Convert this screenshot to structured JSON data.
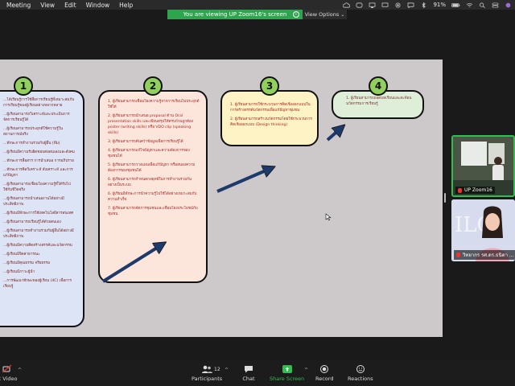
{
  "menubar": {
    "items": [
      "Meeting",
      "View",
      "Edit",
      "Window",
      "Help"
    ],
    "battery": "91%"
  },
  "share_banner": {
    "text": "You are viewing UP Zoom16's screen",
    "view_options": "View Options"
  },
  "slide": {
    "badges": [
      "1",
      "2",
      "3",
      "4"
    ],
    "card1": [
      "...ได้เรียนรู้การใช้สื่อการเรียนรู้ที่เหมาะสมกับการเรียนรู้ของผู้เรียนอย่างหลากหลาย",
      "...ผู้เรียนสามารถวิเคราะห์และประเมินการจัดการเรียนรู้ได้",
      "...ผู้เรียนสามารถประยุกต์ใช้ความรู้ในสถานการณ์จริง",
      "...ทักษะการทำงานร่วมกับผู้อื่น (ทีม)",
      "...ผู้เรียนมีความรับผิดชอบต่อตนเองและสังคม",
      "...ทักษะการสื่อสาร การนำเสนอ การอภิปราย",
      "...ทักษะการคิดวิเคราะห์ สังเคราะห์ และการแก้ปัญหา",
      "...ผู้เรียนสามารถเชื่อมโยงความรู้ที่ได้รับไปใช้กับชีวิตจริง",
      "...ผู้เรียนสามารถนำเสนองานได้อย่างมีประสิทธิภาพ",
      "...ผู้เรียนมีทักษะการใช้เทคโนโลยีสารสนเทศ",
      "...ผู้เรียนสามารถเรียนรู้ได้ด้วยตนเอง",
      "...ผู้เรียนสามารถทำงานร่วมกับผู้อื่นได้อย่างมีประสิทธิภาพ",
      "...ผู้เรียนมีความคิดสร้างสรรค์และนวัตกรรม",
      "...ผู้เรียนมีจิตสาธารณะ",
      "...ผู้เรียนมีคุณธรรม จริยธรรม",
      "...ผู้เรียนมีภาวะผู้นำ",
      "...การพัฒนาทักษะของผู้เรียน (4C) เพื่อการเรียนรู้"
    ],
    "card2": [
      "1. ผู้เรียนสามารถเชื่อมโยงความรู้จากการเรียนไปประยุกต์ใช้ได้",
      "2. ผู้เรียนสามารถนำเสนอ proposal ด้าน Oral presentation skills และเขียนสรุปให้ครบถ้วนถูกต้อง poster (writing skills) หรือ VDO clip (speaking skills)",
      "3. ผู้เรียนสามารถค้นคว้าข้อมูลเพื่อการเรียนรู้ได้",
      "4. ผู้เรียนสามารถแก้ไขปัญหาและความต้องการของชุมชนได้",
      "5. ผู้เรียนสามารถวางแผนเพื่อแก้ปัญหา หรือสนองความต้องการของชุมชนได้",
      "6. ผู้เรียนสามารถกำหนดกลยุทธ์ในการทำงานร่วมกันอย่างเป็นระบบ",
      "6. ผู้เรียนมีทักษะการนำความรู้ไปใช้ได้อย่างเหมาะสมกับความสำเร็จ",
      "7. ผู้เรียนสามารถจัดการชุมชนและเชื่อมโยงประโยชน์กับชุมชน"
    ],
    "card3": [
      "1. ผู้เรียนสามารถใช้กระบวนการคิดเชิงออกแบบในการสร้างสรรค์นวัตกรรมเพื่อแก้ปัญหาชุมชน",
      "2. ผู้เรียนสามารถสร้างนวัตกรรมโดยใช้กระบวนการคิดเชิงออกแบบ (Design thinking)"
    ],
    "card4": [
      "1. ผู้เรียนสามารถถอดบทเรียนและสะท้อนนวัตกรรมการเรียนรู้"
    ]
  },
  "participants": [
    {
      "name": "UP Zoom16"
    },
    {
      "name": "วิทยากร รศ.ดร.ธนิดา ..."
    }
  ],
  "controls": {
    "video_label": "rt Video",
    "participants_label": "Participants",
    "participants_count": "12",
    "chat_label": "Chat",
    "share_label": "Share Screen",
    "record_label": "Record",
    "reactions_label": "Reactions"
  },
  "colors": {
    "share_green": "#2ea44f",
    "badge_green": "#92cf5c",
    "arrow_navy": "#1e3a6a"
  }
}
